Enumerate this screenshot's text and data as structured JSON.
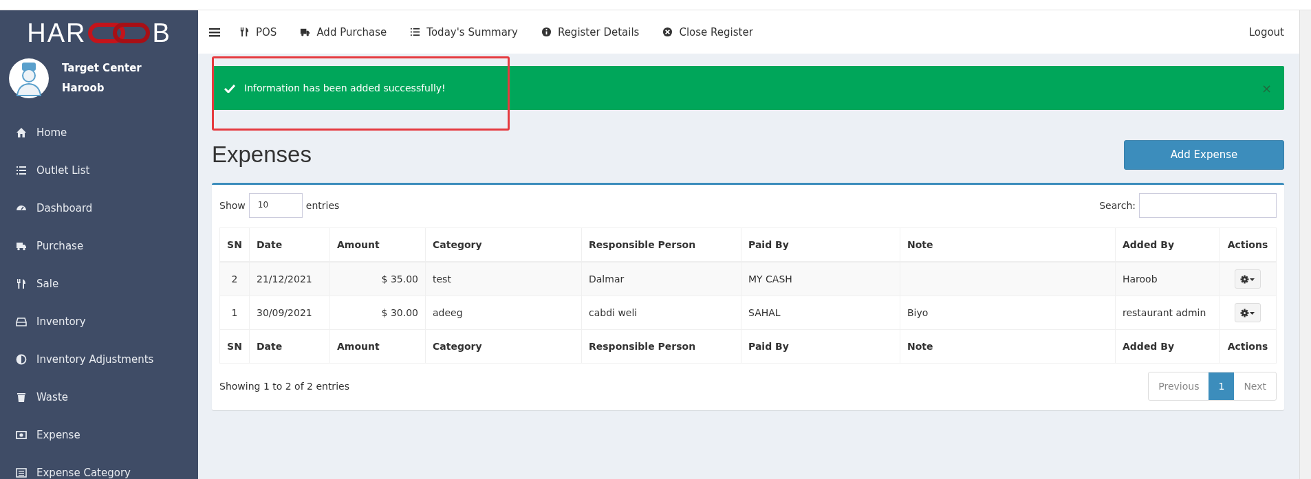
{
  "sidebar": {
    "logo": {
      "left": "HAR",
      "right": "B"
    },
    "user": {
      "outlet": "Target Center",
      "name": "Haroob"
    },
    "items": [
      {
        "label": "Home"
      },
      {
        "label": "Outlet List"
      },
      {
        "label": "Dashboard"
      },
      {
        "label": "Purchase"
      },
      {
        "label": "Sale"
      },
      {
        "label": "Inventory"
      },
      {
        "label": "Inventory Adjustments"
      },
      {
        "label": "Waste"
      },
      {
        "label": "Expense"
      },
      {
        "label": "Expense Category"
      }
    ]
  },
  "topbar": {
    "links": [
      {
        "label": "POS"
      },
      {
        "label": "Add Purchase"
      },
      {
        "label": "Today's Summary"
      },
      {
        "label": "Register Details"
      },
      {
        "label": "Close Register"
      }
    ],
    "logout": "Logout"
  },
  "alert": {
    "message": "Information has been added successfully!",
    "close": "×"
  },
  "page": {
    "title": "Expenses",
    "add_button": "Add Expense"
  },
  "table_controls": {
    "show": "Show",
    "page_size": "10",
    "entries": "entries",
    "search_label": "Search:"
  },
  "table": {
    "columns": [
      "SN",
      "Date",
      "Amount",
      "Category",
      "Responsible Person",
      "Paid By",
      "Note",
      "Added By",
      "Actions"
    ],
    "rows": [
      [
        "2",
        "21/12/2021",
        "$ 35.00",
        "test",
        "Dalmar",
        "MY CASH",
        "",
        "Haroob"
      ],
      [
        "1",
        "30/09/2021",
        "$ 30.00",
        "adeeg",
        "cabdi weli",
        "SAHAL",
        "Biyo",
        "restaurant admin"
      ]
    ],
    "footer_columns": [
      "SN",
      "Date",
      "Amount",
      "Category",
      "Responsible Person",
      "Paid By",
      "Note",
      "Added By",
      "Actions"
    ]
  },
  "footer": {
    "info": "Showing 1 to 2 of 2 entries",
    "pagination": [
      {
        "label": "Previous",
        "disabled": true,
        "selected": false
      },
      {
        "label": "1",
        "disabled": false,
        "selected": true
      },
      {
        "label": "Next",
        "disabled": true,
        "selected": false
      }
    ]
  }
}
